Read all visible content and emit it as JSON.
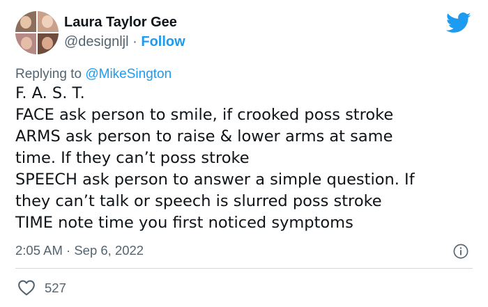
{
  "author": {
    "display_name": "Laura Taylor Gee",
    "handle": "@designljl",
    "separator": "·",
    "follow_label": "Follow"
  },
  "reply": {
    "prefix": "Replying to ",
    "mention": "@MikeSington"
  },
  "body_lines": [
    "F. A. S. T.",
    "FACE ask person to smile, if crooked poss stroke",
    "ARMS ask person to raise & lower arms at same",
    "time. If they can’t poss stroke",
    "SPEECH ask person to answer a simple question. If",
    "they can’t talk or speech is slurred poss stroke",
    "TIME note time you first noticed symptoms"
  ],
  "timestamp": "2:05 AM · Sep 6, 2022",
  "likes": "527",
  "icons": {
    "brand": "twitter-bird-icon",
    "info": "info-icon",
    "like": "heart-icon"
  },
  "colors": {
    "accent": "#1d9bf0",
    "text": "#0f1419",
    "muted": "#536471",
    "divider": "#cfd9de"
  }
}
